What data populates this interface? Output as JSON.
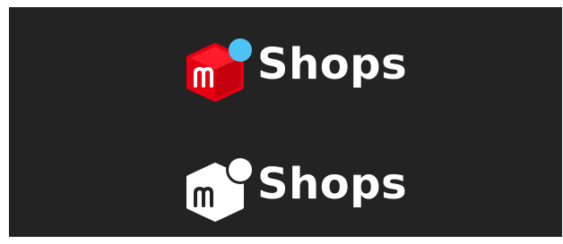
{
  "logos": [
    {
      "variant": "color",
      "wordmark": "Shops",
      "wordmark_color": "#ffffff",
      "colors": {
        "box_face_front": "#E60012",
        "box_face_top": "#FF1A2C",
        "box_face_side": "#B8000E",
        "circle": "#4DC3F7",
        "letter": "#ffffff"
      }
    },
    {
      "variant": "monochrome",
      "wordmark": "Shops",
      "wordmark_color": "#ffffff",
      "colors": {
        "box_face_front": "#ffffff",
        "box_face_top": "#ffffff",
        "box_face_side": "#ffffff",
        "circle": "#ffffff",
        "circle_outline": "#232323",
        "letter": "#232323"
      }
    }
  ],
  "background_color": "#232323"
}
